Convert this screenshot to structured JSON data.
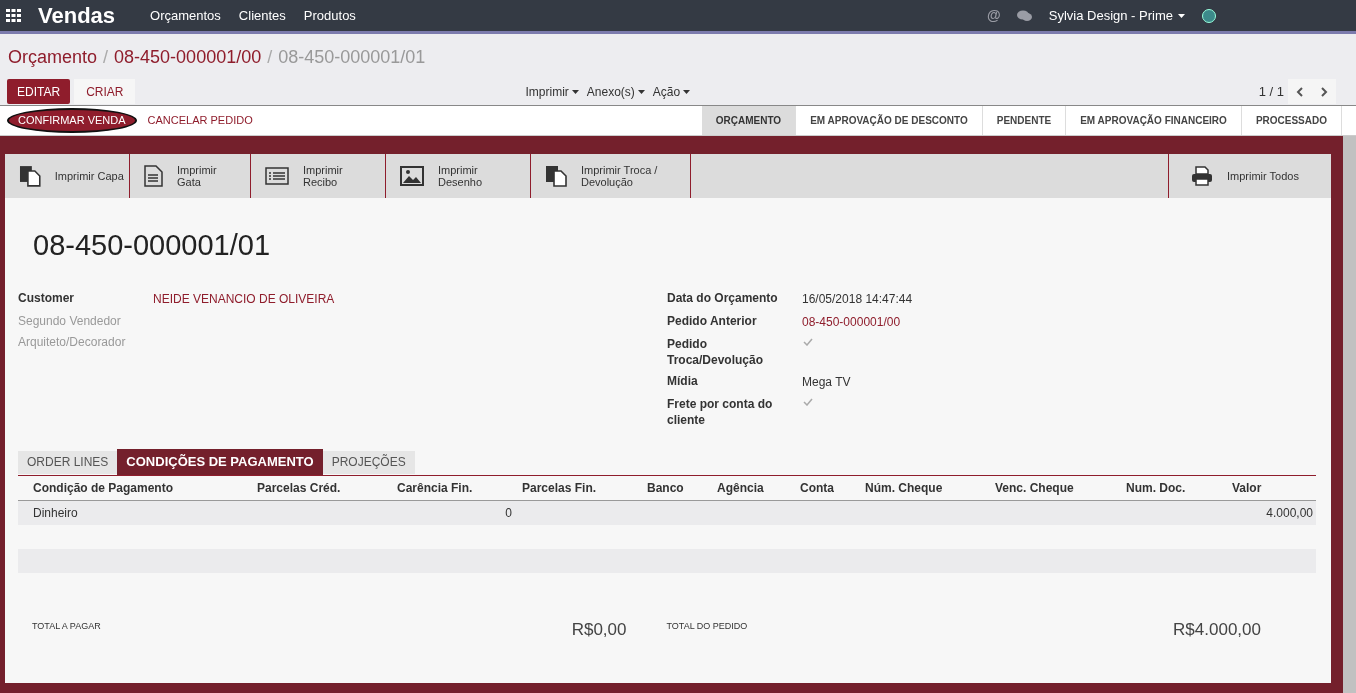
{
  "navbar": {
    "app_title": "Vendas",
    "menu": [
      "Orçamentos",
      "Clientes",
      "Produtos"
    ],
    "mention": "@",
    "user": "Sylvia Design - Prime"
  },
  "breadcrumb": {
    "separator": "/",
    "items": [
      {
        "label": "Orçamento",
        "current": false
      },
      {
        "label": "08-450-000001/00",
        "current": false
      },
      {
        "label": "08-450-000001/01",
        "current": true
      }
    ]
  },
  "buttons": {
    "edit": "EDITAR",
    "create": "CRIAR"
  },
  "dropdowns": [
    "Imprimir",
    "Anexo(s)",
    "Ação"
  ],
  "pager": "1 / 1",
  "actions": {
    "confirm": "CONFIRMAR VENDA",
    "cancel": "CANCELAR PEDIDO"
  },
  "status_steps": [
    {
      "label": "ORÇAMENTO",
      "selected": true
    },
    {
      "label": "EM APROVAÇÃO DE DESCONTO",
      "selected": false
    },
    {
      "label": "PENDENTE",
      "selected": false
    },
    {
      "label": "EM APROVAÇÃO FINANCEIRO",
      "selected": false
    },
    {
      "label": "PROCESSADO",
      "selected": false
    }
  ],
  "print_buttons": [
    {
      "label": "Imprimir Capa",
      "kind": "copy"
    },
    {
      "label": "Imprimir Gata",
      "kind": "document"
    },
    {
      "label": "Imprimir Recibo",
      "kind": "list"
    },
    {
      "label": "Imprimir Desenho",
      "kind": "image"
    },
    {
      "label": "Imprimir Troca / Devolução",
      "kind": "copy"
    }
  ],
  "print_all": "Imprimir Todos",
  "record_title": "08-450-000001/01",
  "left_fields": [
    {
      "label": "Customer",
      "kind": "link",
      "value": "NEIDE VENANCIO DE OLIVEIRA"
    },
    {
      "label": "Segundo Vendedor",
      "kind": "empty"
    },
    {
      "label": "Arquiteto/Decorador",
      "kind": "empty"
    }
  ],
  "right_fields": [
    {
      "label": "Data do Orçamento",
      "kind": "text",
      "value": "16/05/2018 14:47:44"
    },
    {
      "label": "Pedido Anterior",
      "kind": "link",
      "value": "08-450-000001/00"
    },
    {
      "label": "Pedido Troca/Devolução",
      "kind": "check",
      "checked": true
    },
    {
      "label": "Mídia",
      "kind": "text",
      "value": "Mega TV"
    },
    {
      "label": "Frete por conta do cliente",
      "kind": "check",
      "checked": true
    }
  ],
  "tabs": [
    {
      "label": "ORDER LINES",
      "selected": false
    },
    {
      "label": "CONDIÇÕES DE PAGAMENTO",
      "selected": true
    },
    {
      "label": "PROJEÇÕES",
      "selected": false
    }
  ],
  "table": {
    "columns": [
      "Condição de Pagamento",
      "Parcelas Créd.",
      "Carência Fin.",
      "Parcelas Fin.",
      "Banco",
      "Agência",
      "Conta",
      "Núm. Cheque",
      "Venc. Cheque",
      "Num. Doc.",
      "Valor"
    ],
    "rows": [
      {
        "cells": [
          "Dinheiro",
          null,
          "0",
          null,
          null,
          null,
          null,
          null,
          null,
          null,
          "4.000,00"
        ]
      }
    ]
  },
  "totals": [
    {
      "label": "TOTAL A PAGAR",
      "value": "R$0,00"
    },
    {
      "label": "TOTAL DO PEDIDO",
      "value": "R$4.000,00"
    }
  ]
}
